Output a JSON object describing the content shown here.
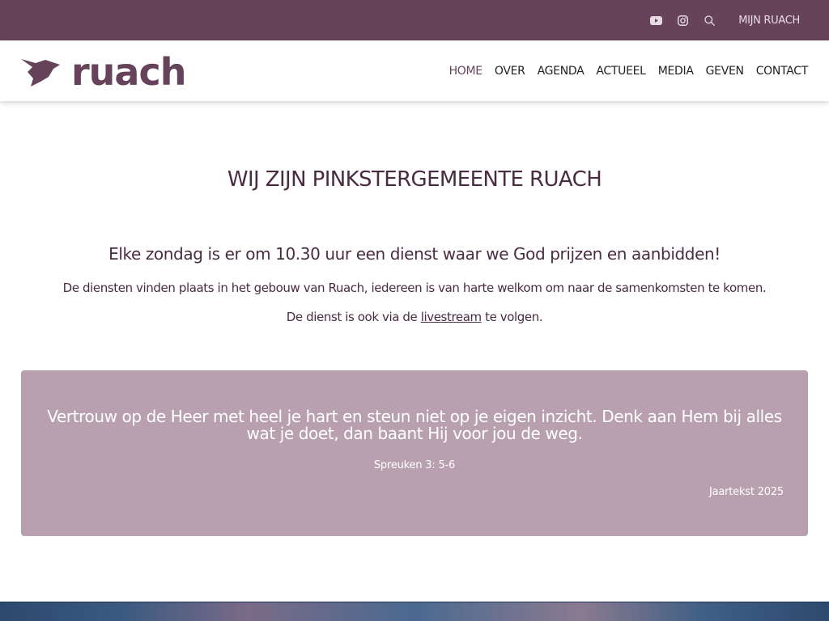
{
  "topbar": {
    "icons": [
      "youtube-icon",
      "instagram-icon",
      "search-icon"
    ],
    "mijn_label": "MIJN RUACH"
  },
  "header": {
    "logo_text": "ruach",
    "nav": [
      {
        "label": "HOME",
        "active": true
      },
      {
        "label": "OVER",
        "active": false
      },
      {
        "label": "AGENDA",
        "active": false
      },
      {
        "label": "ACTUEEL",
        "active": false
      },
      {
        "label": "MEDIA",
        "active": false
      },
      {
        "label": "GEVEN",
        "active": false
      },
      {
        "label": "CONTACT",
        "active": false
      }
    ]
  },
  "main": {
    "title": "WIJ ZIJN PINKSTERGEMEENTE RUACH",
    "lead": "Elke zondag is er om 10.30 uur een dienst waar we God prijzen en aanbidden!",
    "para1": "De diensten vinden plaats in het gebouw van Ruach, iedereen is van harte welkom om naar de samenkomsten te komen.",
    "para2_before": "De dienst is ook via de ",
    "para2_link": "livestream",
    "para2_after": " te volgen."
  },
  "quote": {
    "text": "Vertrouw op de Heer met heel je hart en steun niet op je eigen inzicht. Denk aan Hem bij alles wat je doet, dan baant Hij voor jou de weg.",
    "reference": "Spreuken 3: 5-6",
    "label": "Jaartekst 2025"
  },
  "colors": {
    "brand": "#66435b",
    "quote_bg": "#b8a0ae",
    "text": "#4a2c42"
  }
}
